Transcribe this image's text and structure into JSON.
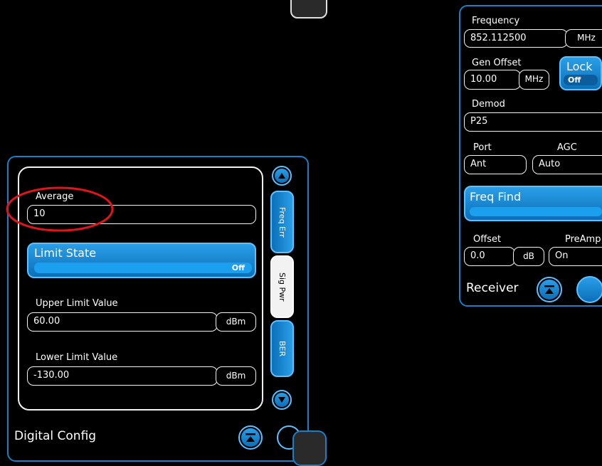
{
  "digital_config": {
    "title": "Digital Config",
    "average": {
      "label": "Average",
      "value": "10"
    },
    "limit_state": {
      "label": "Limit State",
      "value": "Off"
    },
    "upper_limit": {
      "label": "Upper Limit Value",
      "value": "60.00",
      "unit": "dBm"
    },
    "lower_limit": {
      "label": "Lower Limit Value",
      "value": "-130.00",
      "unit": "dBm"
    },
    "tabs": [
      {
        "label": "Freq Err",
        "selected": false
      },
      {
        "label": "Sig Pwr",
        "selected": true
      },
      {
        "label": "BER",
        "selected": false
      }
    ]
  },
  "receiver": {
    "title": "Receiver",
    "frequency": {
      "label": "Frequency",
      "value": "852.112500",
      "unit": "MHz"
    },
    "gen_offset": {
      "label": "Gen Offset",
      "value": "10.00",
      "unit": "MHz"
    },
    "lock": {
      "label": "Lock",
      "value": "Off"
    },
    "demod": {
      "label": "Demod",
      "value": "P25"
    },
    "port": {
      "label": "Port",
      "value": "Ant"
    },
    "agc": {
      "label": "AGC",
      "value": "Auto"
    },
    "freq_find": {
      "label": "Freq Find"
    },
    "offset": {
      "label": "Offset",
      "value": "0.0",
      "unit": "dB"
    },
    "preamp": {
      "label": "PreAmp",
      "value": "On"
    }
  },
  "colors": {
    "panel_border": "#1a7fc4",
    "accent_blue": "#1aa0ee",
    "annotation_red": "#e0141c"
  }
}
